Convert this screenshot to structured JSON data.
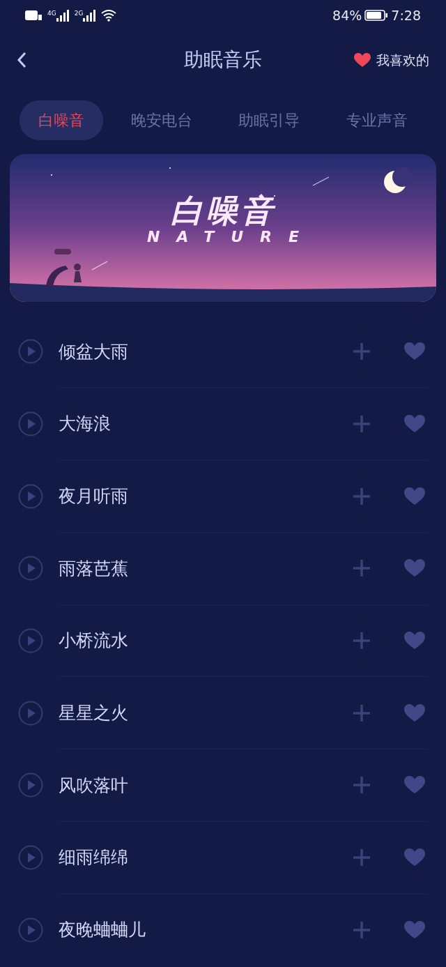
{
  "status_bar": {
    "battery_text": "84%",
    "time": "7:28",
    "network_1": "4G",
    "network_2": "2G"
  },
  "header": {
    "title": "助眠音乐",
    "favorites_link": "我喜欢的"
  },
  "tabs": [
    {
      "label": "白噪音",
      "selected": true
    },
    {
      "label": "晚安电台",
      "selected": false
    },
    {
      "label": "助眠引导",
      "selected": false
    },
    {
      "label": "专业声音",
      "selected": false
    }
  ],
  "banner": {
    "kind": "picture",
    "title": "白噪音",
    "subtitle": "NATURE"
  },
  "tracks": [
    {
      "name": "倾盆大雨",
      "favorite": false
    },
    {
      "name": "大海浪",
      "favorite": false
    },
    {
      "name": "夜月听雨",
      "favorite": false
    },
    {
      "name": "雨落芭蕉",
      "favorite": false
    },
    {
      "name": "小桥流水",
      "favorite": false
    },
    {
      "name": "星星之火",
      "favorite": false
    },
    {
      "name": "风吹落叶",
      "favorite": false
    },
    {
      "name": "细雨绵绵",
      "favorite": false
    },
    {
      "name": "夜晚蛐蛐儿",
      "favorite": false
    }
  ]
}
